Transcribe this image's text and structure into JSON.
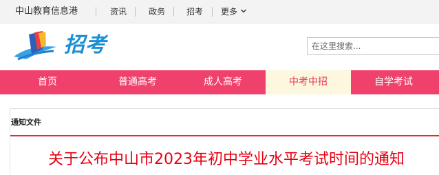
{
  "topbar": {
    "site_name": "中山教育信息港",
    "links": [
      "资讯",
      "政务",
      "招考",
      "更多"
    ]
  },
  "header": {
    "logo_text": "招考",
    "search_placeholder": "在这里搜索..."
  },
  "mainnav": {
    "tabs": [
      "首页",
      "普通高考",
      "成人高考",
      "中考中招",
      "自学考试"
    ],
    "active_tab": "中考中招"
  },
  "notice": {
    "section_title": "通知文件",
    "article_title": "关于公布中山市2023年初中学业水平考试时间的通知"
  },
  "colors": {
    "nav_bg": "#f0406c",
    "active_tab_bg": "#fdf7dd",
    "title_red": "#e60012",
    "logo_blue": "#1a8fd6"
  }
}
